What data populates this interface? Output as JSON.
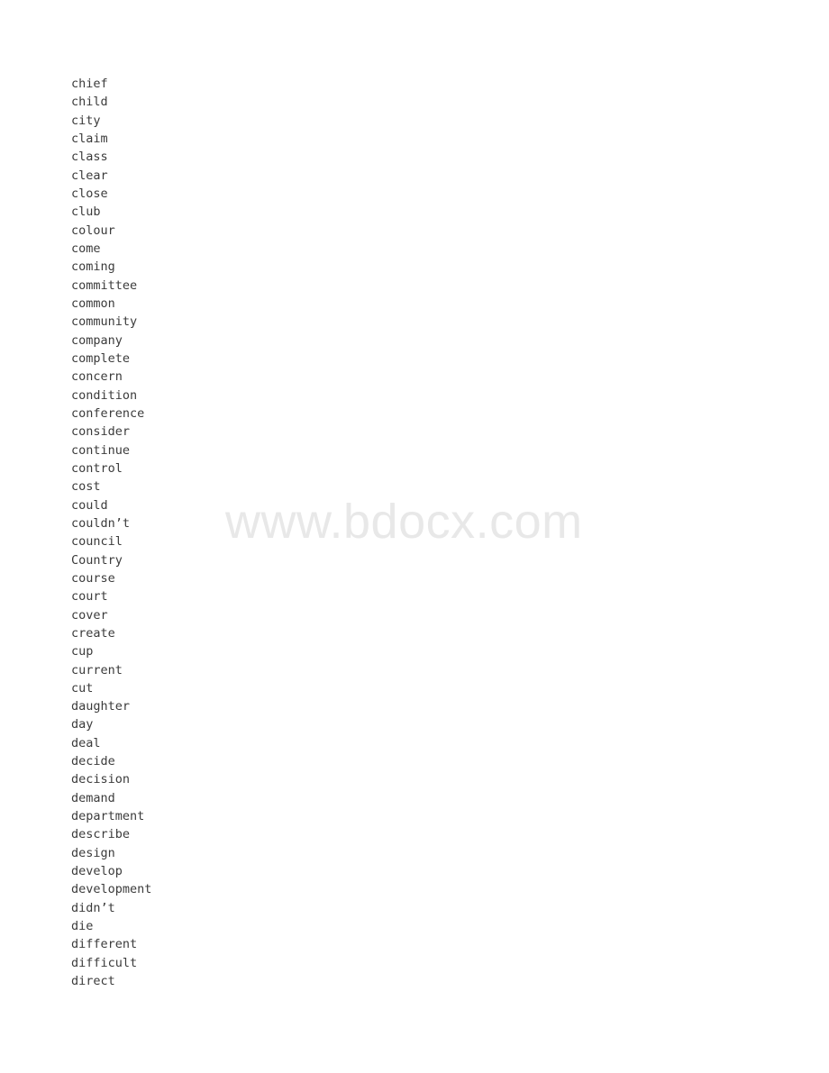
{
  "document": {
    "page_background": "#ffffff",
    "text_color": "#3b3b3b",
    "watermark": {
      "text": "www.bdocx.com",
      "color": "#e8e8e8"
    },
    "word_list": [
      "chief",
      "child",
      "city",
      "claim",
      "class",
      "clear",
      "close",
      "club",
      "colour",
      "come",
      "coming",
      "committee",
      "common",
      "community",
      "company",
      "complete",
      "concern",
      "condition",
      "conference",
      "consider",
      "continue",
      "control",
      "cost",
      "could",
      "couldn’t",
      "council",
      "Country",
      "course",
      "court",
      "cover",
      "create",
      "cup",
      "current",
      "cut",
      "daughter",
      "day",
      "deal",
      "decide",
      "decision",
      "demand",
      "department",
      "describe",
      "design",
      "develop",
      "development",
      "didn’t",
      "die",
      "different",
      "difficult",
      "direct"
    ]
  }
}
